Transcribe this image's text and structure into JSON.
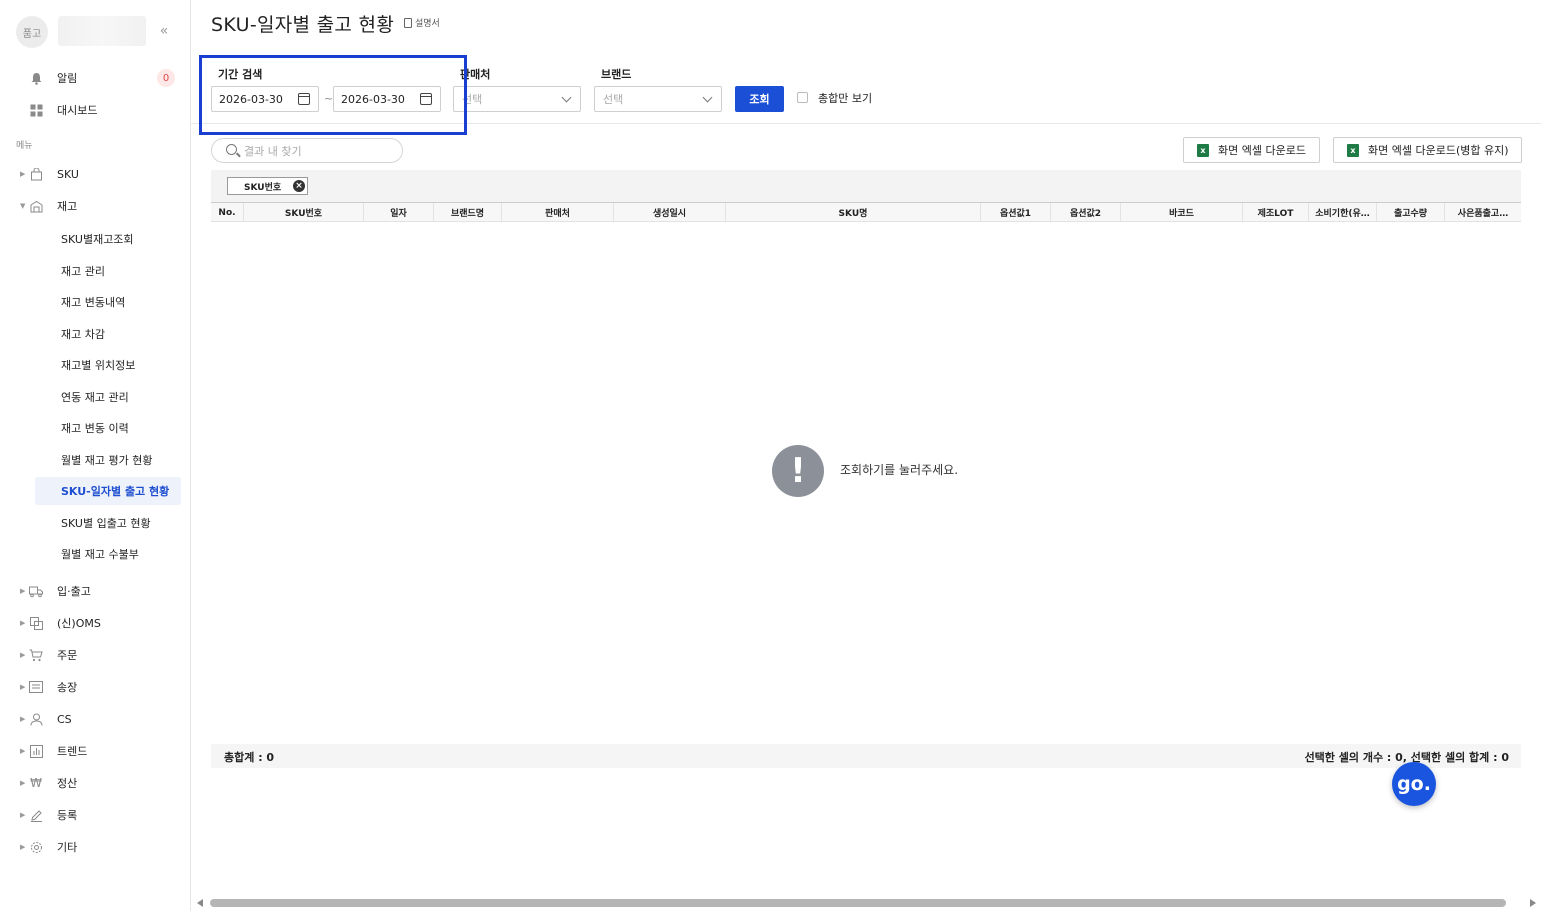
{
  "sidebar": {
    "avatar_text": "품고",
    "alert_label": "알림",
    "alert_count": "0",
    "dashboard_label": "대시보드",
    "menu_caption": "메뉴",
    "sku_label": "SKU",
    "inventory_label": "재고",
    "inventory_sub": [
      "SKU별재고조회",
      "재고 관리",
      "재고 변동내역",
      "재고 차감",
      "재고별 위치정보",
      "연동 재고 관리",
      "재고 변동 이력",
      "월별 재고 평가 현황",
      "SKU-일자별 출고 현황",
      "SKU별 입출고 현황",
      "월별 재고 수불부"
    ],
    "other_groups": [
      "입·출고",
      "(신)OMS",
      "주문",
      "송장",
      "CS",
      "트렌드",
      "정산",
      "등록",
      "기타"
    ]
  },
  "page": {
    "title": "SKU-일자별 출고 현황",
    "manual_label": "설명서"
  },
  "filters": {
    "period_label": "기간 검색",
    "date_from": "2026-03-30",
    "date_to": "2026-03-30",
    "tilde": "~",
    "seller_label": "판매처",
    "seller_placeholder": "선택",
    "brand_label": "브랜드",
    "brand_placeholder": "선택",
    "search_button": "조회",
    "total_only_label": "총합만 보기"
  },
  "toolbar": {
    "find_placeholder": "결과 내 찾기",
    "excel_download": "화면 엑셀 다운로드",
    "excel_download_merged": "화면 엑셀 다운로드(병합 유지)"
  },
  "group_chip": "SKU번호",
  "table": {
    "columns": [
      "No.",
      "SKU번호",
      "일자",
      "브랜드명",
      "판매처",
      "생성일시",
      "SKU명",
      "옵션값1",
      "옵션값2",
      "바코드",
      "제조LOT",
      "소비기한(유…",
      "출고수량",
      "사은품출고…"
    ]
  },
  "empty_message": "조회하기를 눌러주세요.",
  "footer": {
    "total": "총합계 : 0",
    "selection": "선택한 셀의 개수 : 0, 선택한 셀의 합계 : 0"
  },
  "fab_label": "go."
}
